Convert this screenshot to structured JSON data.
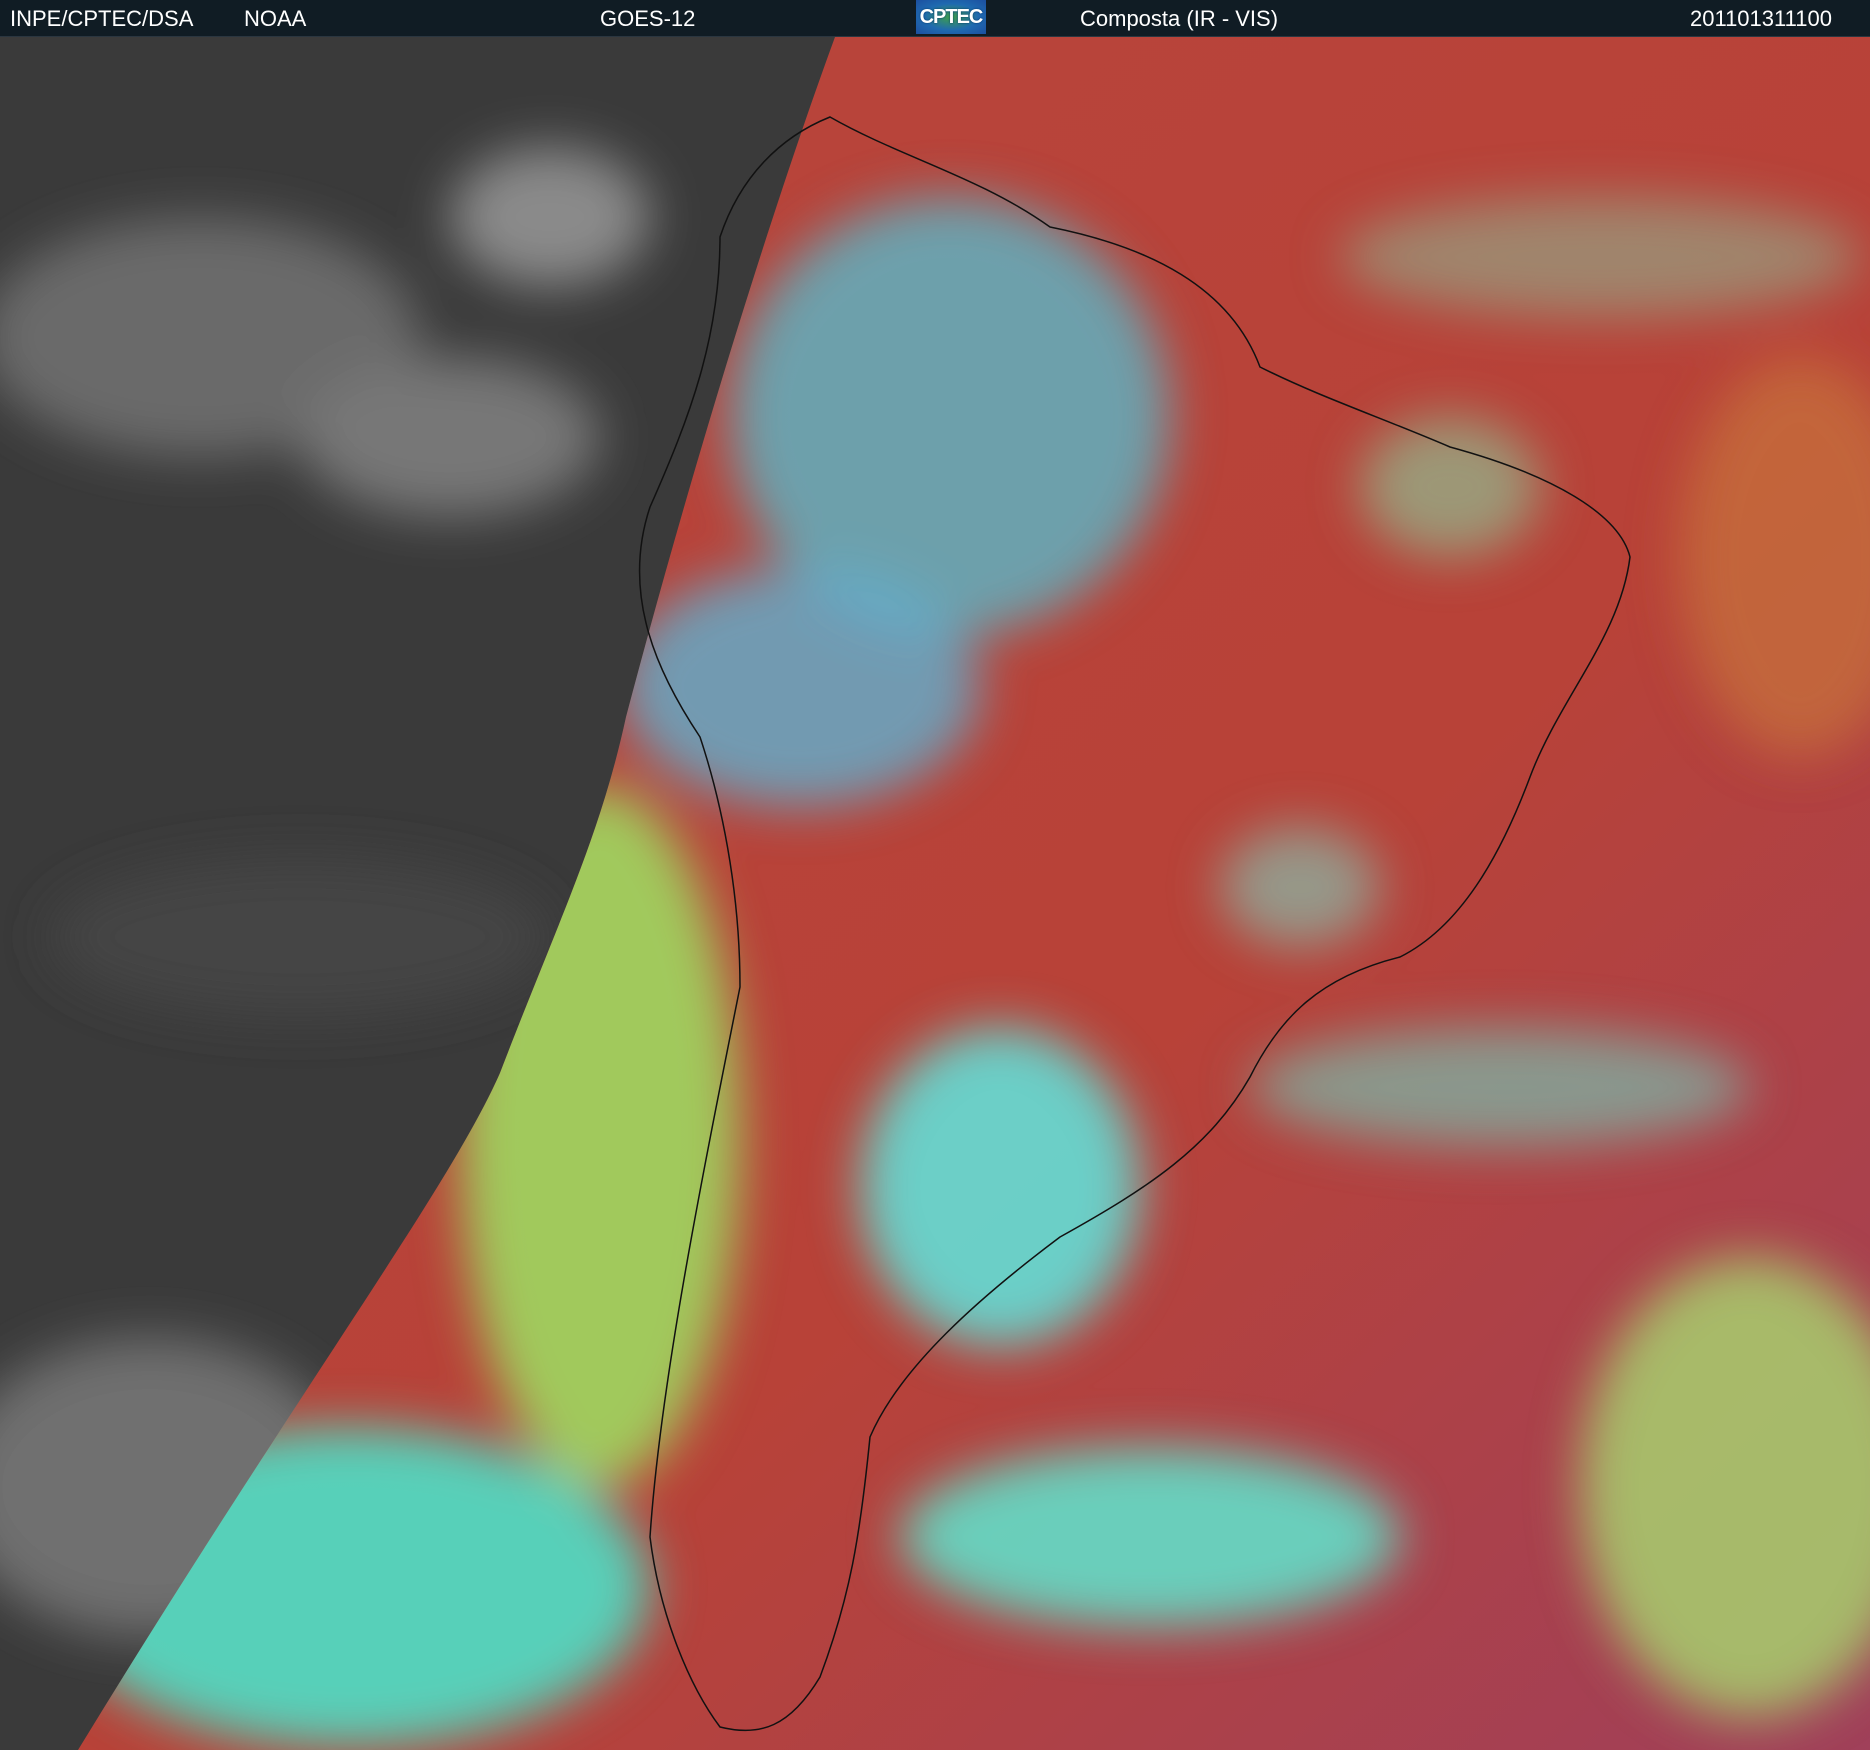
{
  "header": {
    "agency": "INPE/CPTEC/DSA",
    "source": "NOAA",
    "satellite": "GOES-12",
    "logo_text": "CPTEC",
    "product": "Composta (IR - VIS)",
    "timestamp": "201101311100"
  },
  "colors": {
    "header_bg": "#101c24",
    "night_gray": "#3a3a3a",
    "clear_red": "#b8433c",
    "cloud_cyan": "#4ee8e0",
    "cloud_green": "#9ee060"
  }
}
